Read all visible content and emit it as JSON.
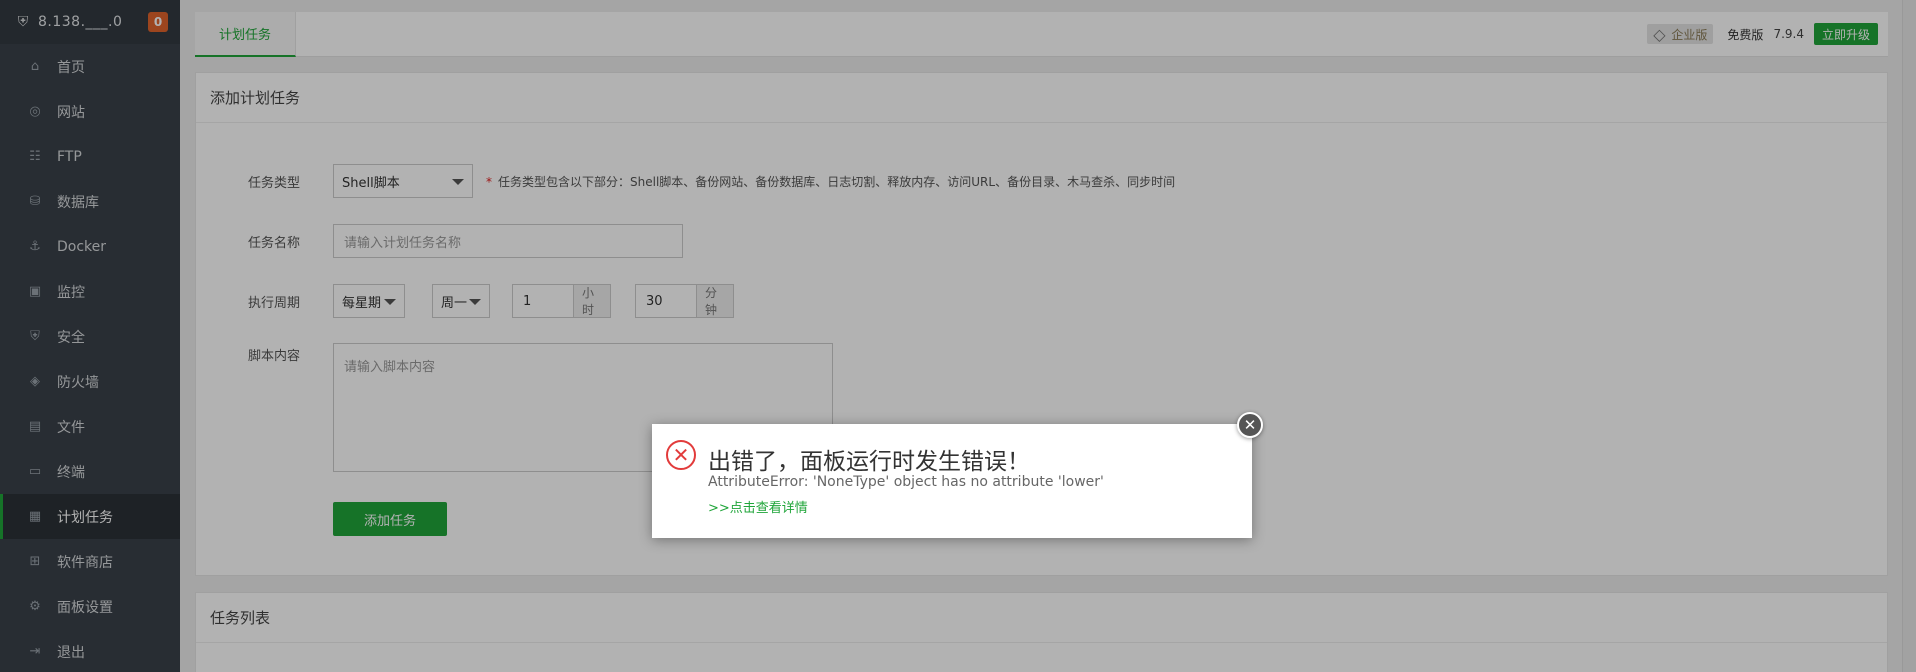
{
  "sidebar": {
    "ip": "8.138.___.0",
    "badge": "0",
    "items": [
      {
        "label": "首页"
      },
      {
        "label": "网站"
      },
      {
        "label": "FTP"
      },
      {
        "label": "数据库"
      },
      {
        "label": "Docker"
      },
      {
        "label": "监控"
      },
      {
        "label": "安全"
      },
      {
        "label": "防火墙"
      },
      {
        "label": "文件"
      },
      {
        "label": "终端"
      },
      {
        "label": "计划任务"
      },
      {
        "label": "软件商店"
      },
      {
        "label": "面板设置"
      },
      {
        "label": "退出"
      }
    ]
  },
  "topbar": {
    "tab": "计划任务",
    "enterprise": "企业版",
    "free": "免费版",
    "version": "7.9.4",
    "upgrade": "立即升级"
  },
  "form": {
    "title": "添加计划任务",
    "type_label": "任务类型",
    "type_value": "Shell脚本",
    "type_note": "任务类型包含以下部分：Shell脚本、备份网站、备份数据库、日志切割、释放内存、访问URL、备份目录、木马查杀、同步时间",
    "name_label": "任务名称",
    "name_placeholder": "请输入计划任务名称",
    "cycle_label": "执行周期",
    "cycle_value": "每星期",
    "weekday_value": "周一",
    "hour_value": "1",
    "hour_unit": "小时",
    "minute_value": "30",
    "minute_unit": "分钟",
    "script_label": "脚本内容",
    "script_placeholder": "请输入脚本内容",
    "submit": "添加任务"
  },
  "list": {
    "title": "任务列表"
  },
  "dialog": {
    "title": "出错了，面板运行时发生错误！",
    "message": "AttributeError: 'NoneType' object has no attribute 'lower'",
    "link": ">>点击查看详情"
  },
  "colors": {
    "accent": "#20a53a",
    "sidebar": "#3a4149",
    "error": "#e23b3b",
    "badge": "#e0642c"
  }
}
